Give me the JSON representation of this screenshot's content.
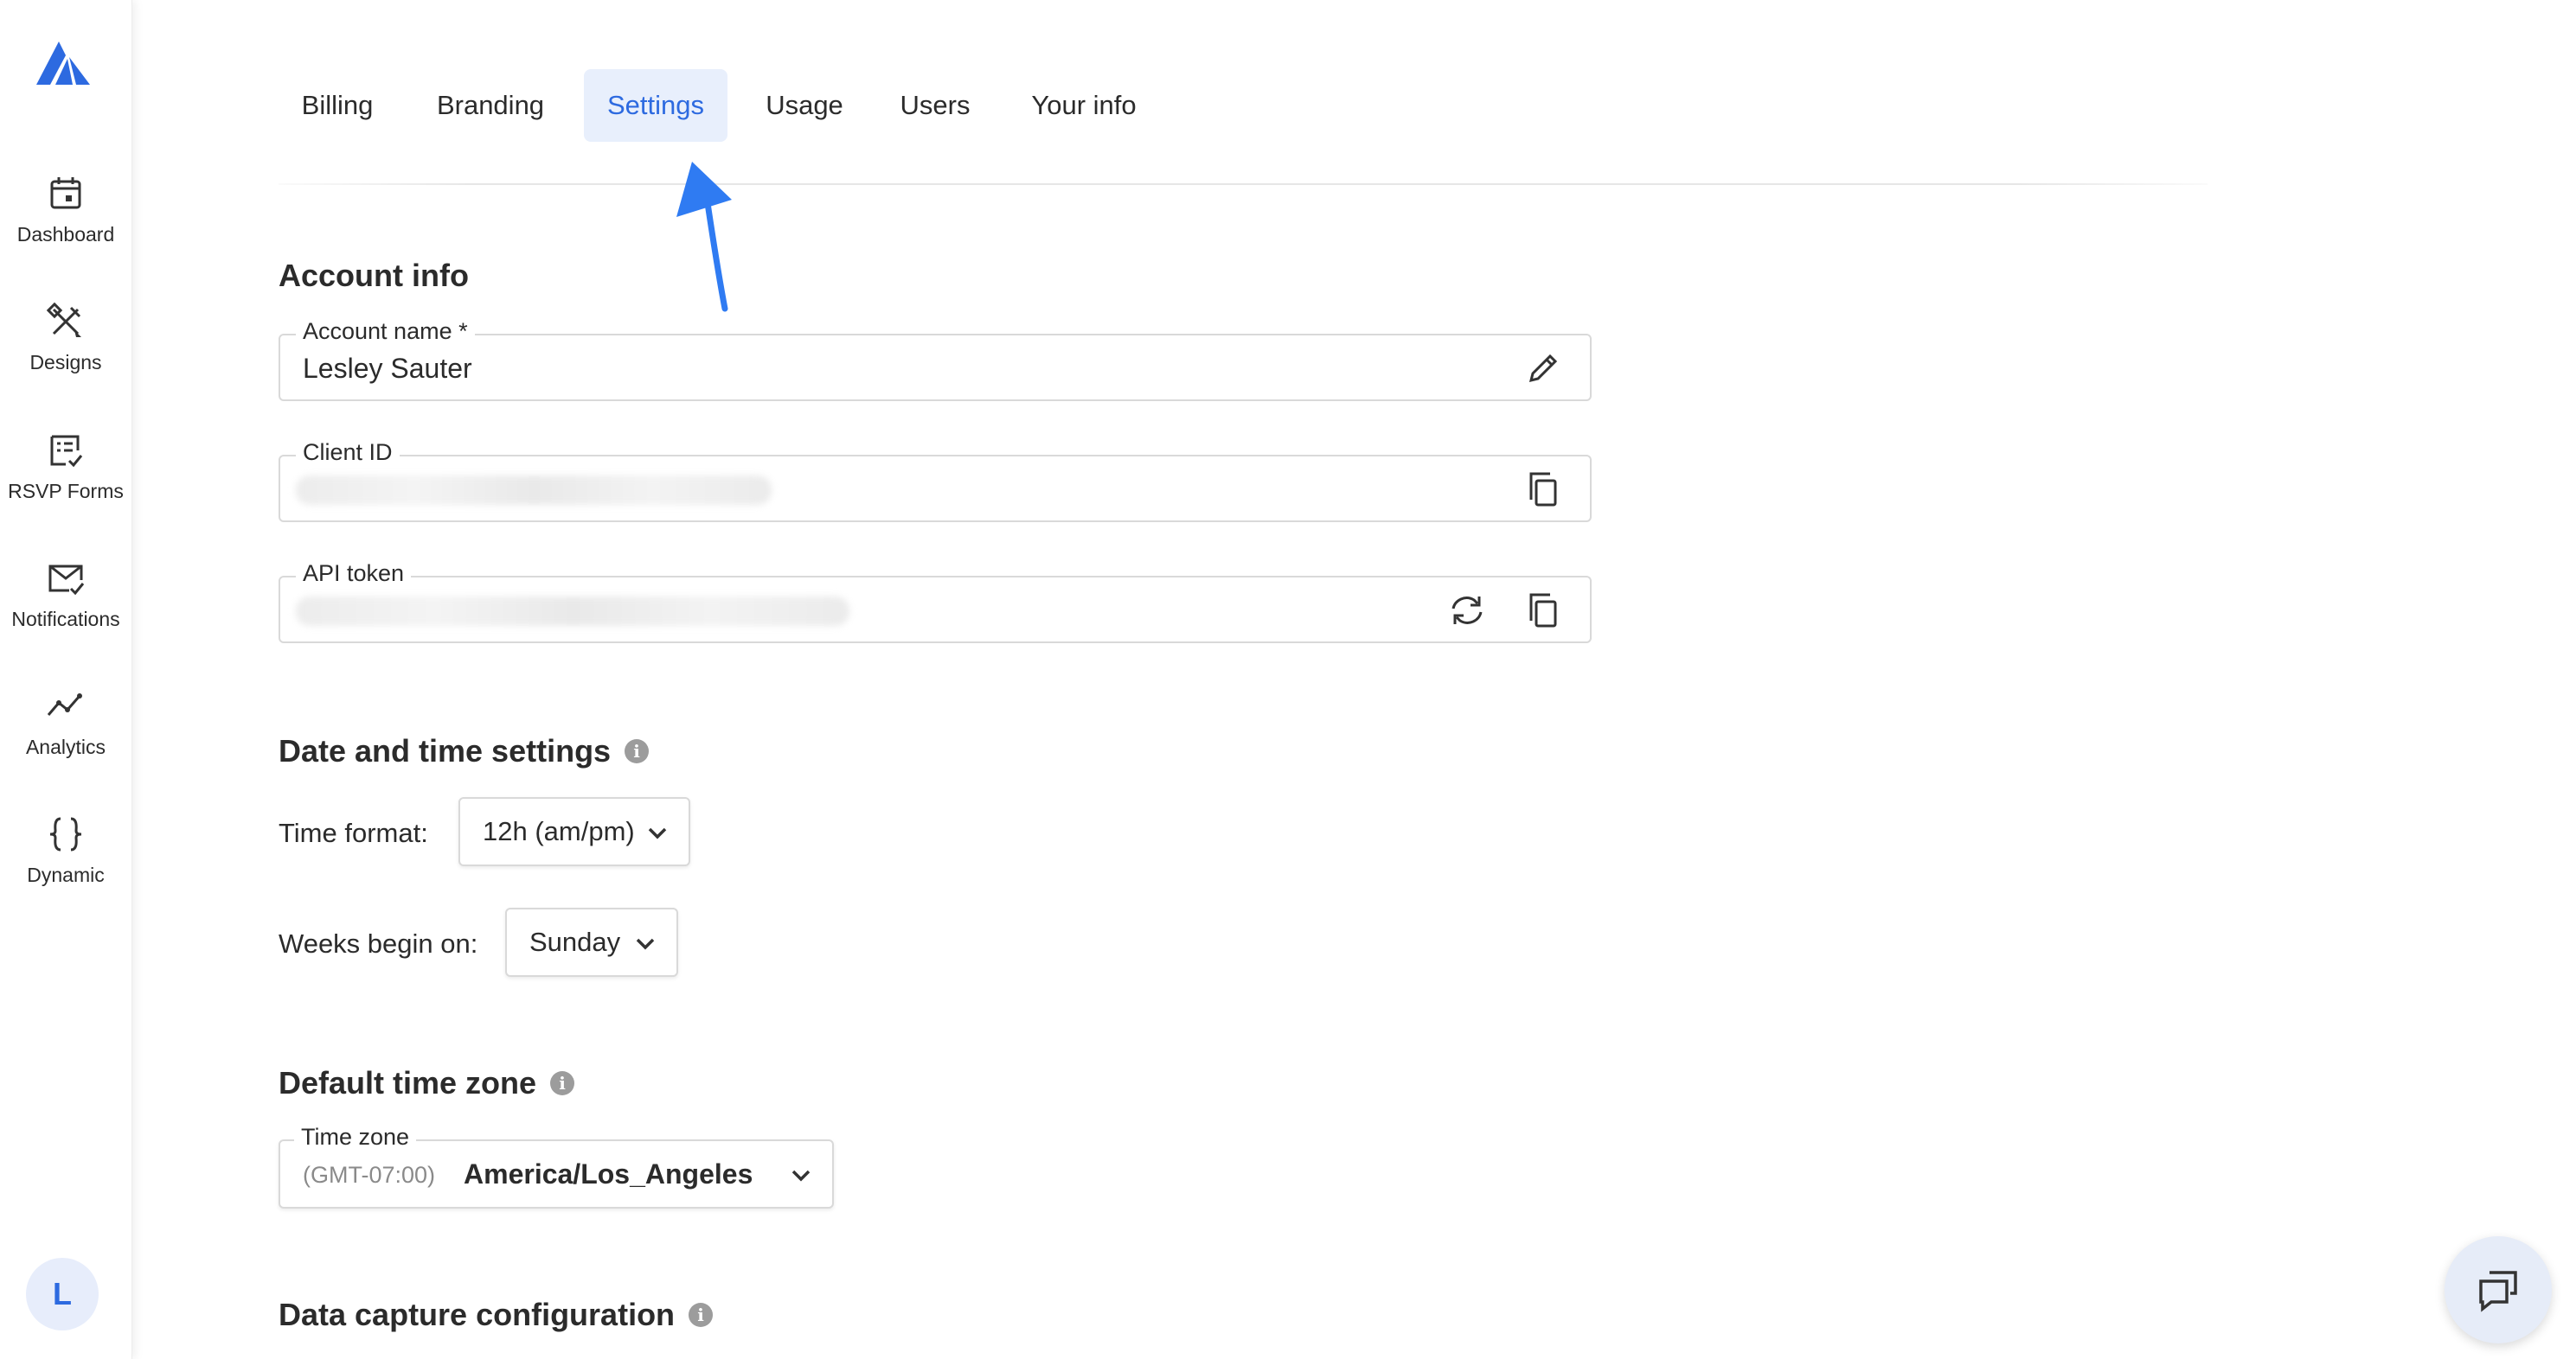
{
  "sidebar": {
    "items": [
      {
        "label": "Dashboard",
        "icon": "calendar-icon"
      },
      {
        "label": "Designs",
        "icon": "designs-icon"
      },
      {
        "label": "RSVP Forms",
        "icon": "rsvp-form-icon"
      },
      {
        "label": "Notifications",
        "icon": "mail-check-icon"
      },
      {
        "label": "Analytics",
        "icon": "trend-line-icon"
      },
      {
        "label": "Dynamic",
        "icon": "curly-braces-icon"
      }
    ],
    "avatar_initial": "L"
  },
  "tabs": [
    {
      "label": "Billing",
      "active": false
    },
    {
      "label": "Branding",
      "active": false
    },
    {
      "label": "Settings",
      "active": true
    },
    {
      "label": "Usage",
      "active": false
    },
    {
      "label": "Users",
      "active": false
    },
    {
      "label": "Your info",
      "active": false
    }
  ],
  "account_info": {
    "title": "Account info",
    "account_name": {
      "label": "Account name *",
      "value": "Lesley Sauter"
    },
    "client_id": {
      "label": "Client ID"
    },
    "api_token": {
      "label": "API token"
    }
  },
  "date_time": {
    "title": "Date and time settings",
    "time_format": {
      "label": "Time format:",
      "value": "12h (am/pm)"
    },
    "weeks_begin": {
      "label": "Weeks begin on:",
      "value": "Sunday"
    }
  },
  "time_zone": {
    "title": "Default time zone",
    "label": "Time zone",
    "offset": "(GMT-07:00)",
    "value": "America/Los_Angeles"
  },
  "data_capture": {
    "title": "Data capture configuration"
  },
  "colors": {
    "accent": "#2d6ae0",
    "active_tab_bg": "#e8effc",
    "annotation_arrow": "#2f7bf2"
  }
}
